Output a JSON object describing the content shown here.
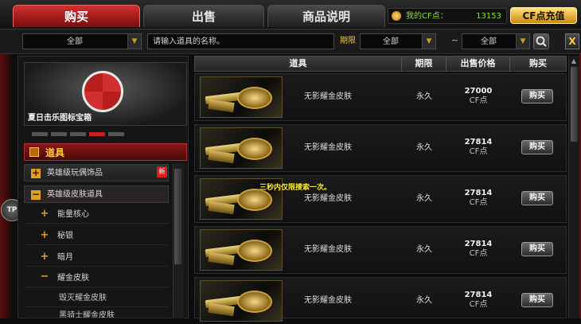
{
  "tabs": [
    {
      "label": "购买",
      "active": true
    },
    {
      "label": "出售",
      "active": false
    },
    {
      "label": "商品说明",
      "active": false
    }
  ],
  "balance": {
    "label": "我的CF点：",
    "value": "13153"
  },
  "recharge_label": "CF点充值",
  "filters": {
    "category": "全部",
    "search_placeholder": "请输入道具的名称。",
    "period_label": "期限",
    "period_value": "全部",
    "range_separator": "~",
    "price_value": "全部",
    "close_label": "X"
  },
  "banner": {
    "title": "夏日击乐图标宝箱"
  },
  "sidebar": {
    "header": "道具",
    "items": [
      {
        "label": "英雄级玩偶饰品",
        "icon": "plus",
        "badge": "新"
      },
      {
        "label": "英雄级皮肤道具",
        "icon": "minus"
      },
      {
        "label": "能量核心",
        "icon": "plus"
      },
      {
        "label": "秘银",
        "icon": "plus"
      },
      {
        "label": "暗月",
        "icon": "plus"
      },
      {
        "label": "耀金皮肤",
        "icon": "minus"
      },
      {
        "label": "毁灭耀金皮肤"
      },
      {
        "label": "黑骑士耀金皮肤"
      }
    ]
  },
  "table": {
    "headers": [
      "道具",
      "期限",
      "出售价格",
      "购买"
    ],
    "rows": [
      {
        "name": "无影耀金皮肤",
        "period": "永久",
        "price": "27000",
        "unit": "CF点",
        "buy": "购买"
      },
      {
        "name": "无影耀金皮肤",
        "period": "永久",
        "price": "27814",
        "unit": "CF点",
        "buy": "购买"
      },
      {
        "name": "无影耀金皮肤",
        "period": "永久",
        "price": "27814",
        "unit": "CF点",
        "buy": "购买"
      },
      {
        "name": "无影耀金皮肤",
        "period": "永久",
        "price": "27814",
        "unit": "CF点",
        "buy": "购买"
      },
      {
        "name": "无影耀金皮肤",
        "period": "永久",
        "price": "27814",
        "unit": "CF点",
        "buy": "购买"
      }
    ]
  },
  "notice": "三秒内仅限搜索一次。",
  "logo_text": "TP",
  "colors": {
    "accent_red": "#c82020",
    "gold": "#e0a020",
    "cf_green": "#8ddb3a",
    "notice_yellow": "#ffee33"
  }
}
